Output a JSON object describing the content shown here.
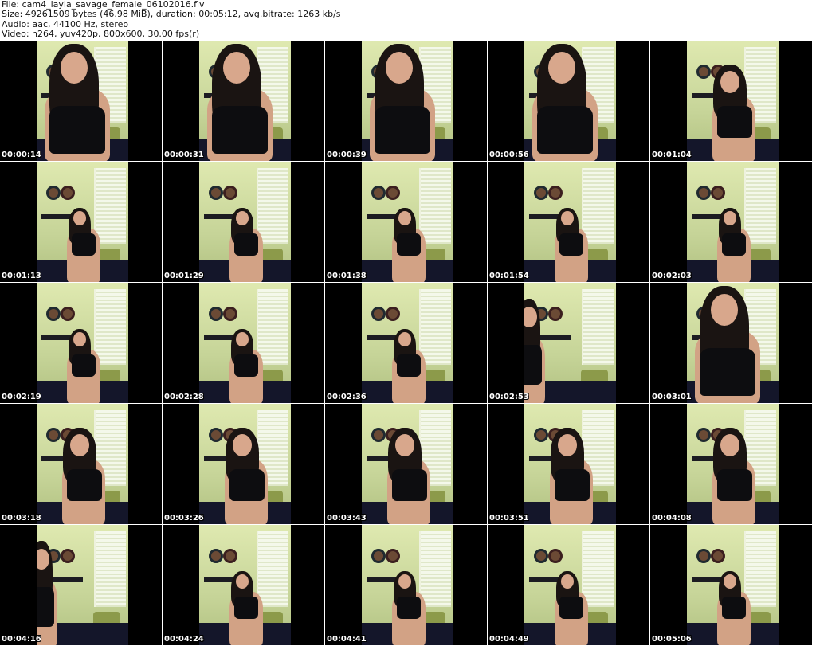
{
  "header": {
    "file_line": "File: cam4_layla_savage_female_06102016.flv",
    "size_line": "Size: 49261509 bytes (46.98 MiB), duration: 00:05:12, avg.bitrate: 1263 kb/s",
    "audio_line": "Audio: aac, 44100 Hz, stereo",
    "video_line": "Video: h264, yuv420p, 800x600, 30.00 fps(r)"
  },
  "thumbnails": [
    {
      "timestamp": "00:00:14",
      "shot": "closeup"
    },
    {
      "timestamp": "00:00:31",
      "shot": "closeup"
    },
    {
      "timestamp": "00:00:39",
      "shot": "closeup"
    },
    {
      "timestamp": "00:00:56",
      "shot": "closeup"
    },
    {
      "timestamp": "00:01:04",
      "shot": "medium"
    },
    {
      "timestamp": "00:01:13",
      "shot": "wide"
    },
    {
      "timestamp": "00:01:29",
      "shot": "wide"
    },
    {
      "timestamp": "00:01:38",
      "shot": "wide"
    },
    {
      "timestamp": "00:01:54",
      "shot": "wide"
    },
    {
      "timestamp": "00:02:03",
      "shot": "wide"
    },
    {
      "timestamp": "00:02:19",
      "shot": "wide"
    },
    {
      "timestamp": "00:02:28",
      "shot": "wide"
    },
    {
      "timestamp": "00:02:36",
      "shot": "wide"
    },
    {
      "timestamp": "00:02:53",
      "shot": "edge"
    },
    {
      "timestamp": "00:03:01",
      "shot": "closeup"
    },
    {
      "timestamp": "00:03:18",
      "shot": "medium"
    },
    {
      "timestamp": "00:03:26",
      "shot": "medium"
    },
    {
      "timestamp": "00:03:43",
      "shot": "medium"
    },
    {
      "timestamp": "00:03:51",
      "shot": "medium"
    },
    {
      "timestamp": "00:04:08",
      "shot": "medium"
    },
    {
      "timestamp": "00:04:16",
      "shot": "edge"
    },
    {
      "timestamp": "00:04:24",
      "shot": "wide"
    },
    {
      "timestamp": "00:04:41",
      "shot": "wide"
    },
    {
      "timestamp": "00:04:49",
      "shot": "wide"
    },
    {
      "timestamp": "00:05:06",
      "shot": "wide"
    }
  ]
}
